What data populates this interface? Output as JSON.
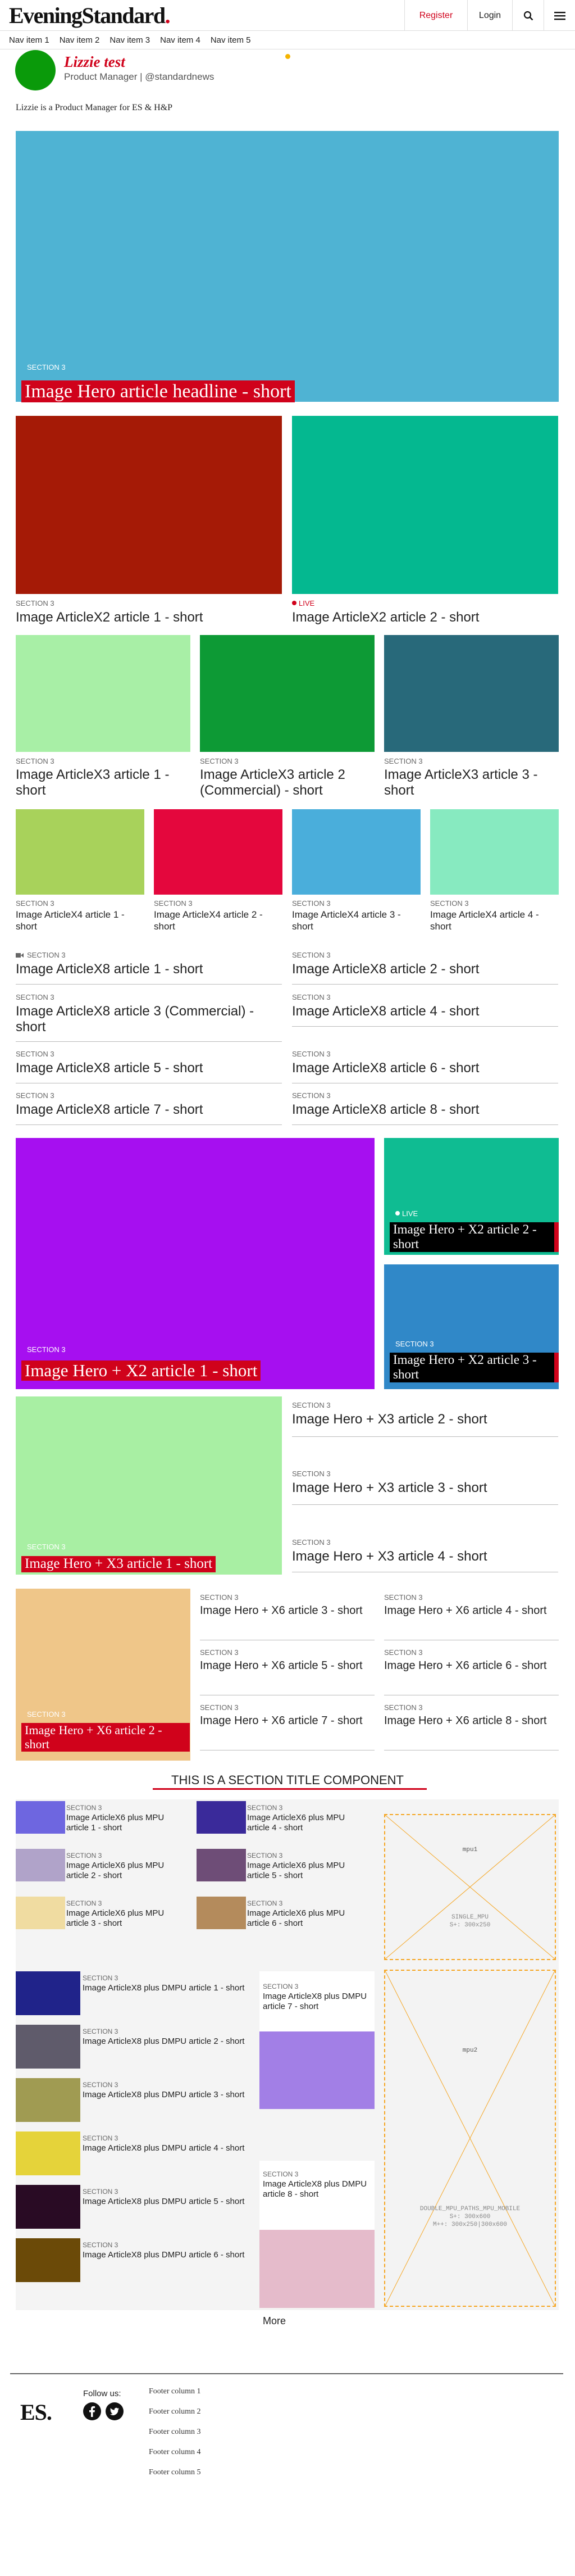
{
  "header": {
    "logo_main": "EveningStandard",
    "logo_dot": ".",
    "register": "Register",
    "login": "Login"
  },
  "nav": [
    "Nav item 1",
    "Nav item 2",
    "Nav item 3",
    "Nav item 4",
    "Nav item 5"
  ],
  "author": {
    "name": "Lizzie test",
    "role": "Product Manager | @standardnews",
    "bio": "Lizzie is a Product Manager for ES & H&P"
  },
  "colors": {
    "brand_red": "#d0021b",
    "hero": "#4fb3d3",
    "x2_1": "#a51a06",
    "x2_2": "#04b890",
    "x3_1": "#a8efa6",
    "x3_2": "#0d9a35",
    "x3_3": "#28697a",
    "x4_1": "#a8d25b",
    "x4_2": "#e4073d",
    "x4_3": "#4aaedb",
    "x4_4": "#87eac0",
    "hx2_main": "#a60ff0",
    "hx2_2": "#0fbc92",
    "hx2_3": "#3088c8",
    "hx3_main": "#a8efa3",
    "hx6_main": "#efc689",
    "mpu_thumbs": [
      "#6e66e0",
      "#b0a3c9",
      "#f0dca1",
      "#3a2a9a",
      "#6e4d77",
      "#b48b5c"
    ],
    "dmpu_thumbs": [
      "#20238a",
      "#5f5b6b",
      "#a09b52",
      "#e5d33a",
      "#290b24",
      "#6b4a08"
    ],
    "dmpu_center": [
      "#a27fe6",
      "#e5bbcb"
    ]
  },
  "sections": {
    "label": "SECTION 3",
    "live": "LIVE",
    "hero": "Image Hero article headline - short",
    "x2": [
      "Image ArticleX2 article 1 - short",
      "Image ArticleX2 article 2 - short"
    ],
    "x3": [
      "Image ArticleX3 article 1 - short",
      "Image ArticleX3 article 2 (Commercial) - short",
      "Image ArticleX3 article 3 - short"
    ],
    "x4": [
      "Image ArticleX4 article 1 - short",
      "Image ArticleX4 article 2 - short",
      "Image ArticleX4 article 3 - short",
      "Image ArticleX4 article 4 - short"
    ],
    "x8": [
      "Image ArticleX8 article 1 - short",
      "Image ArticleX8 article 2 - short",
      "Image ArticleX8 article 3 (Commercial) - short",
      "Image ArticleX8 article 4 - short",
      "Image ArticleX8 article 5 - short",
      "Image ArticleX8 article 6 - short",
      "Image ArticleX8 article 7 - short",
      "Image ArticleX8 article 8 - short"
    ],
    "hx2": [
      "Image Hero + X2 article 1 - short",
      "Image Hero + X2 article 2 - short",
      "Image Hero + X2 article 3 - short"
    ],
    "hx3": [
      "Image Hero + X3 article 1 - short",
      "Image Hero + X3 article 2 - short",
      "Image Hero + X3 article 3 - short",
      "Image Hero + X3 article 4 - short"
    ],
    "hx6": [
      "Image Hero + X6 article 2 - short",
      "Image Hero + X6 article 3 - short",
      "Image Hero + X6 article 4 - short",
      "Image Hero + X6 article 5 - short",
      "Image Hero + X6 article 6 - short",
      "Image Hero + X6 article 7 - short",
      "Image Hero + X6 article 8 - short"
    ],
    "section_title": "THIS IS A SECTION TITLE COMPONENT",
    "mpu_articles": [
      "Image ArticleX6 plus MPU article 1 - short",
      "Image ArticleX6 plus MPU article 2 - short",
      "Image ArticleX6 plus MPU article 3 - short",
      "Image ArticleX6 plus MPU article 4 - short",
      "Image ArticleX6 plus MPU article 5 - short",
      "Image ArticleX6 plus MPU article 6 - short"
    ],
    "dmpu_articles": [
      "Image ArticleX8 plus DMPU article 1 - short",
      "Image ArticleX8 plus DMPU article 2 - short",
      "Image ArticleX8 plus DMPU article 3 - short",
      "Image ArticleX8 plus DMPU article 4 - short",
      "Image ArticleX8 plus DMPU article 5 - short",
      "Image ArticleX8 plus DMPU article 6 - short",
      "Image ArticleX8 plus DMPU article 7 - short",
      "Image ArticleX8 plus DMPU article 8 - short"
    ],
    "more": "More"
  },
  "ads": {
    "mpu1": {
      "name": "mpu1",
      "line1": "SINGLE_MPU",
      "line2": "S+: 300x250"
    },
    "mpu2": {
      "name": "mpu2",
      "line1": "DOUBLE_MPU_PATHS_MPU_MOBILE",
      "line2": "S+: 300x600",
      "line3": "M++: 300x250|300x600"
    }
  },
  "footer": {
    "logo": "ES.",
    "follow": "Follow us:",
    "columns": [
      "Footer column 1",
      "Footer column 2",
      "Footer column 3",
      "Footer column 4",
      "Footer column 5"
    ]
  }
}
